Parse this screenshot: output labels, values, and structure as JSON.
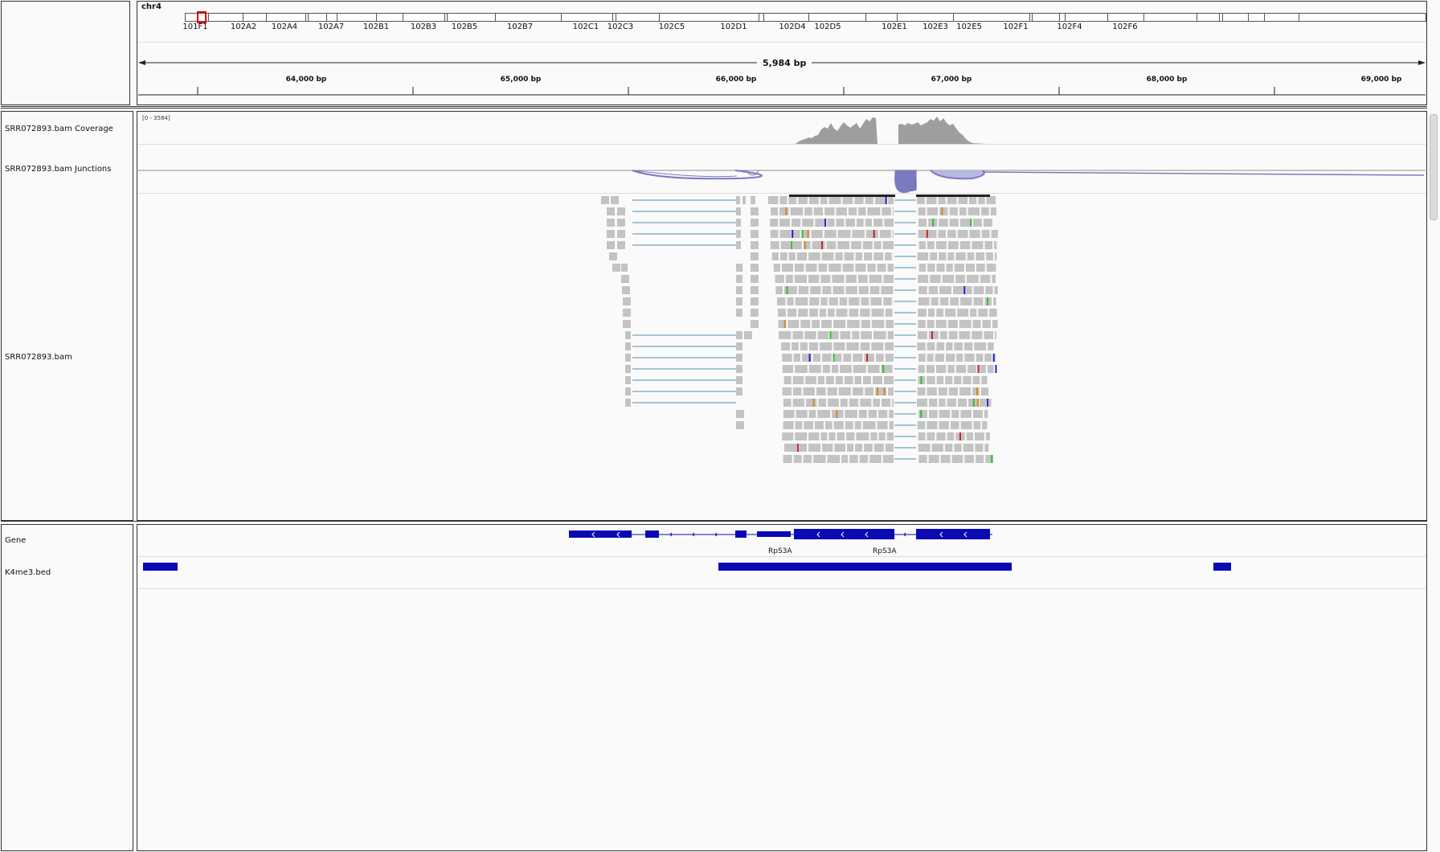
{
  "header": {
    "chromosome": "chr4",
    "span_label": "5,984 bp",
    "cytobands": [
      "101F1",
      "102A2",
      "102A4",
      "102A7",
      "102B1",
      "102B3",
      "102B5",
      "102B7",
      "102C1",
      "102C3",
      "102C5",
      "102D1",
      "102D4",
      "102D5",
      "102E1",
      "102E3",
      "102E5",
      "102F1",
      "102F4",
      "102F6"
    ],
    "ruler_ticks": [
      "64,000 bp",
      "65,000 bp",
      "66,000 bp",
      "67,000 bp",
      "68,000 bp",
      "69,000 bp"
    ]
  },
  "tracks": {
    "coverage": {
      "name": "SRR072893.bam Coverage",
      "range": "[0 - 3584]"
    },
    "junctions": {
      "name": "SRR072893.bam Junctions"
    },
    "alignments": {
      "name": "SRR072893.bam"
    },
    "gene": {
      "name": "Gene",
      "labels": [
        "RpS3A",
        "RpS3A"
      ]
    },
    "bed": {
      "name": "K4me3.bed"
    }
  },
  "colors": {
    "read": "#c3c3c3",
    "gene": "#0a0ab4",
    "junction": "#7a7ac0",
    "coverage": "#9e9e9e",
    "mismatch_a": "#2dc02d",
    "mismatch_c": "#2020d0",
    "mismatch_g": "#d08a20",
    "mismatch_t": "#d02020"
  }
}
